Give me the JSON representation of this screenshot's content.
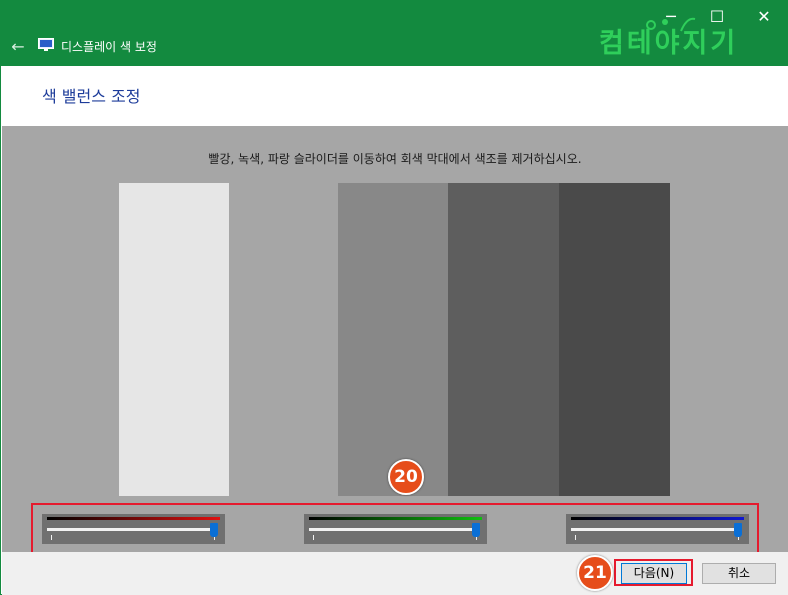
{
  "window": {
    "title": "디스플레이 색 보정",
    "back_icon": "←",
    "min_icon": "─",
    "max_icon": "☐",
    "close_icon": "✕",
    "accent_color": "#138a3f"
  },
  "logo": {
    "text": "컴테야지기"
  },
  "header": {
    "heading": "색 밸런스 조정"
  },
  "content": {
    "instruction": "빨강, 녹색, 파랑 슬라이더를 이동하여 회색 막대에서 색조를 제거하십시오.",
    "bar_colors": [
      "#e6e6e6",
      "#a6a6a6",
      "#888888",
      "#5e5e5e",
      "#4a4a4a"
    ]
  },
  "sliders": [
    {
      "channel": "red",
      "color": "#e01010",
      "value_fraction": 1.0
    },
    {
      "channel": "green",
      "color": "#10c010",
      "value_fraction": 1.0
    },
    {
      "channel": "blue",
      "color": "#1018d0",
      "value_fraction": 1.0
    }
  ],
  "buttons": {
    "next": "다음(N)",
    "cancel": "취소"
  },
  "annotations": {
    "badge_sliders": "20",
    "badge_next": "21",
    "highlight_color": "#e51a2e",
    "badge_color": "#e64d1a"
  }
}
